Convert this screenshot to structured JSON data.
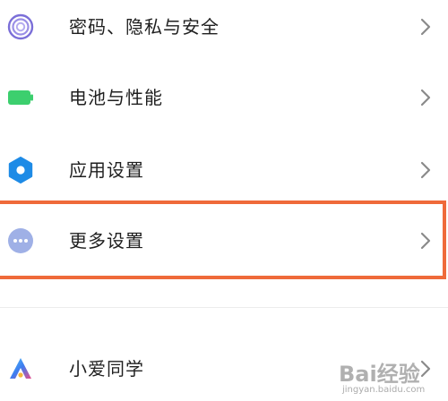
{
  "settings": {
    "items": [
      {
        "id": "password",
        "label": "密码、隐私与安全",
        "icon": "fingerprint-icon",
        "icon_color": "#7b6fd8"
      },
      {
        "id": "battery",
        "label": "电池与性能",
        "icon": "battery-icon",
        "icon_color": "#3ccf6e"
      },
      {
        "id": "apps",
        "label": "应用设置",
        "icon": "gear-icon",
        "icon_color": "#1e8be6"
      },
      {
        "id": "more",
        "label": "更多设置",
        "icon": "more-dots-icon",
        "icon_color": "#9fb0e6"
      },
      {
        "id": "xiaoai",
        "label": "小爱同学",
        "icon": "xiaoai-icon",
        "icon_color": "#3d7cf0"
      }
    ]
  },
  "highlight": {
    "target": "more",
    "color": "#ef6a3a"
  },
  "watermark": {
    "text": "Bai经验",
    "url": "jingyan.baidu.com"
  },
  "colors": {
    "chevron": "#8a8a8a",
    "text": "#1f1f1f",
    "divider": "#ececec"
  }
}
